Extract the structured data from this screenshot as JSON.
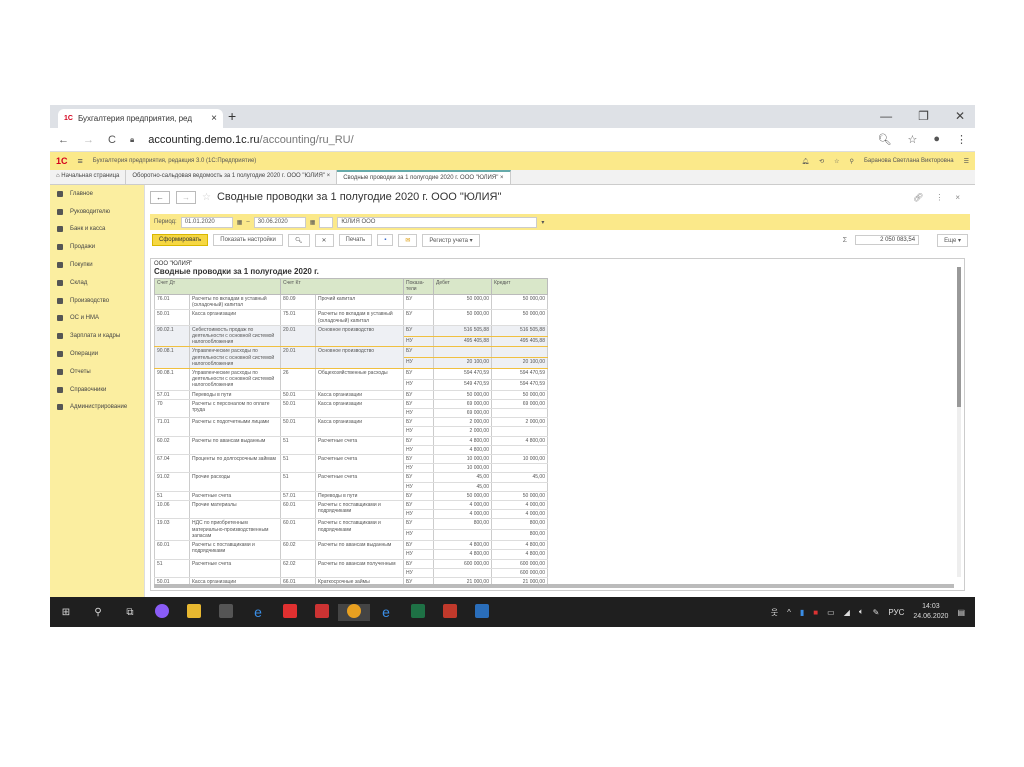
{
  "browser": {
    "tab_title": "Бухгалтерия предприятия, ред",
    "url_host": "accounting.demo.1c.ru",
    "url_path": "/accounting/ru_RU/",
    "new_tab": "+",
    "min": "—",
    "max": "❐",
    "close": "✕"
  },
  "app": {
    "logo": "1С",
    "title": "Бухгалтерия предприятия, редакция 3.0  (1С:Предприятие)",
    "user": "Баранова Светлана Викторовна"
  },
  "open_tabs": [
    "Начальная страница",
    "Оборотно-сальдовая ведомость за 1 полугодие 2020 г. ООО \"ЮЛИЯ\"  ×",
    "Сводные проводки за 1 полугодие 2020 г. ООО \"ЮЛИЯ\"  ×"
  ],
  "sidebar": [
    "Главное",
    "Руководителю",
    "Банк и касса",
    "Продажи",
    "Покупки",
    "Склад",
    "Производство",
    "ОС и НМА",
    "Зарплата и кадры",
    "Операции",
    "Отчеты",
    "Справочники",
    "Администрирование"
  ],
  "form": {
    "title": "Сводные проводки за 1 полугодие 2020 г. ООО \"ЮЛИЯ\"",
    "period_label": "Период:",
    "date_from": "01.01.2020",
    "dash": "–",
    "date_to": "30.06.2020",
    "org": "ЮЛИЯ ООО",
    "generate": "Сформировать",
    "show_settings": "Показать настройки",
    "print": "Печать",
    "register": "Регистр учета ▾",
    "sum_symbol": "Σ",
    "sum": "2 050 083,54",
    "more": "Еще ▾"
  },
  "report": {
    "org": "ООО \"ЮЛИЯ\"",
    "title": "Сводные проводки за 1 полугодие 2020 г.",
    "headers": [
      "Счет Дт",
      "",
      "Счет Кт",
      "",
      "Показа-тели",
      "Дебет",
      "Кредит"
    ],
    "rows": [
      {
        "dt": "76.01",
        "dt_name": "Расчеты по вкладам в уставный (складочный) капитал",
        "kt": "80.09",
        "kt_name": "Прочий капитал",
        "lines": [
          [
            "БУ",
            "50 000,00",
            "50 000,00"
          ]
        ]
      },
      {
        "dt": "50.01",
        "dt_name": "Касса организации",
        "kt": "75.01",
        "kt_name": "Расчеты по вкладам в уставный (складочный) капитал",
        "lines": [
          [
            "БУ",
            "50 000,00",
            "50 000,00"
          ]
        ]
      },
      {
        "dt": "90.02.1",
        "dt_name": "Себестоимость продаж по деятельности с основной системой налогообложения",
        "kt": "20.01",
        "kt_name": "Основное производство",
        "hl": true,
        "lines": [
          [
            "БУ",
            "516 505,88",
            "516 505,88"
          ],
          [
            "НУ",
            "495 405,88",
            "495 405,88"
          ]
        ]
      },
      {
        "dt": "90.08.1",
        "dt_name": "Управленческие расходы по деятельности с основной системой налогообложения",
        "kt": "20.01",
        "kt_name": "Основное производство",
        "hl": true,
        "lines": [
          [
            "БУ",
            "",
            ""
          ],
          [
            "НУ",
            "20 100,00",
            "20 100,00"
          ]
        ]
      },
      {
        "dt": "90.08.1",
        "dt_name": "Управленческие расходы по деятельности с основной системой налогообложения",
        "kt": "26",
        "kt_name": "Общехозяйственные расходы",
        "lines": [
          [
            "БУ",
            "594 470,59",
            "594 470,59"
          ],
          [
            "НУ",
            "549 470,59",
            "594 470,59"
          ]
        ]
      },
      {
        "dt": "57.01",
        "dt_name": "Переводы в пути",
        "kt": "50.01",
        "kt_name": "Касса организации",
        "lines": [
          [
            "БУ",
            "50 000,00",
            "50 000,00"
          ]
        ]
      },
      {
        "dt": "70",
        "dt_name": "Расчеты с персоналом по оплате труда",
        "kt": "50.01",
        "kt_name": "Касса организации",
        "lines": [
          [
            "БУ",
            "69 000,00",
            "69 000,00"
          ],
          [
            "НУ",
            "69 000,00",
            ""
          ]
        ]
      },
      {
        "dt": "71.01",
        "dt_name": "Расчеты с подотчетными лицами",
        "kt": "50.01",
        "kt_name": "Касса организации",
        "lines": [
          [
            "БУ",
            "2 000,00",
            "2 000,00"
          ],
          [
            "НУ",
            "2 000,00",
            ""
          ]
        ]
      },
      {
        "dt": "60.02",
        "dt_name": "Расчеты по авансам выданным",
        "kt": "51",
        "kt_name": "Расчетные счета",
        "lines": [
          [
            "БУ",
            "4 800,00",
            "4 800,00"
          ],
          [
            "НУ",
            "4 800,00",
            ""
          ]
        ]
      },
      {
        "dt": "67.04",
        "dt_name": "Проценты по долгосрочным займам",
        "kt": "51",
        "kt_name": "Расчетные счета",
        "lines": [
          [
            "БУ",
            "10 000,00",
            "10 000,00"
          ],
          [
            "НУ",
            "10 000,00",
            ""
          ]
        ]
      },
      {
        "dt": "91.02",
        "dt_name": "Прочие расходы",
        "kt": "51",
        "kt_name": "Расчетные счета",
        "lines": [
          [
            "БУ",
            "45,00",
            "45,00"
          ],
          [
            "НУ",
            "45,00",
            ""
          ]
        ]
      },
      {
        "dt": "51",
        "dt_name": "Расчетные счета",
        "kt": "57.01",
        "kt_name": "Переводы в пути",
        "lines": [
          [
            "БУ",
            "50 000,00",
            "50 000,00"
          ]
        ]
      },
      {
        "dt": "10.06",
        "dt_name": "Прочие материалы",
        "kt": "60.01",
        "kt_name": "Расчеты с поставщиками и подрядчиками",
        "lines": [
          [
            "БУ",
            "4 000,00",
            "4 000,00"
          ],
          [
            "НУ",
            "4 000,00",
            "4 000,00"
          ]
        ]
      },
      {
        "dt": "19.03",
        "dt_name": "НДС по приобретенным материально-производственным запасам",
        "kt": "60.01",
        "kt_name": "Расчеты с поставщиками и подрядчиками",
        "lines": [
          [
            "БУ",
            "800,00",
            "800,00"
          ],
          [
            "НУ",
            "",
            "800,00"
          ]
        ]
      },
      {
        "dt": "60.01",
        "dt_name": "Расчеты с поставщиками и подрядчиками",
        "kt": "60.02",
        "kt_name": "Расчеты по авансам выданным",
        "lines": [
          [
            "БУ",
            "4 800,00",
            "4 800,00"
          ],
          [
            "НУ",
            "4 800,00",
            "4 800,00"
          ]
        ]
      },
      {
        "dt": "51",
        "dt_name": "Расчетные счета",
        "kt": "62.02",
        "kt_name": "Расчеты по авансам полученным",
        "lines": [
          [
            "БУ",
            "600 000,00",
            "600 000,00"
          ],
          [
            "НУ",
            "",
            "600 000,00"
          ]
        ]
      },
      {
        "dt": "50.01",
        "dt_name": "Касса организации",
        "kt": "66.01",
        "kt_name": "Краткосрочные займы",
        "lines": [
          [
            "БУ",
            "21 000,00",
            "21 000,00"
          ]
        ]
      }
    ]
  },
  "taskbar": {
    "lang": "РУС",
    "time": "14:03",
    "date": "24.06.2020"
  }
}
